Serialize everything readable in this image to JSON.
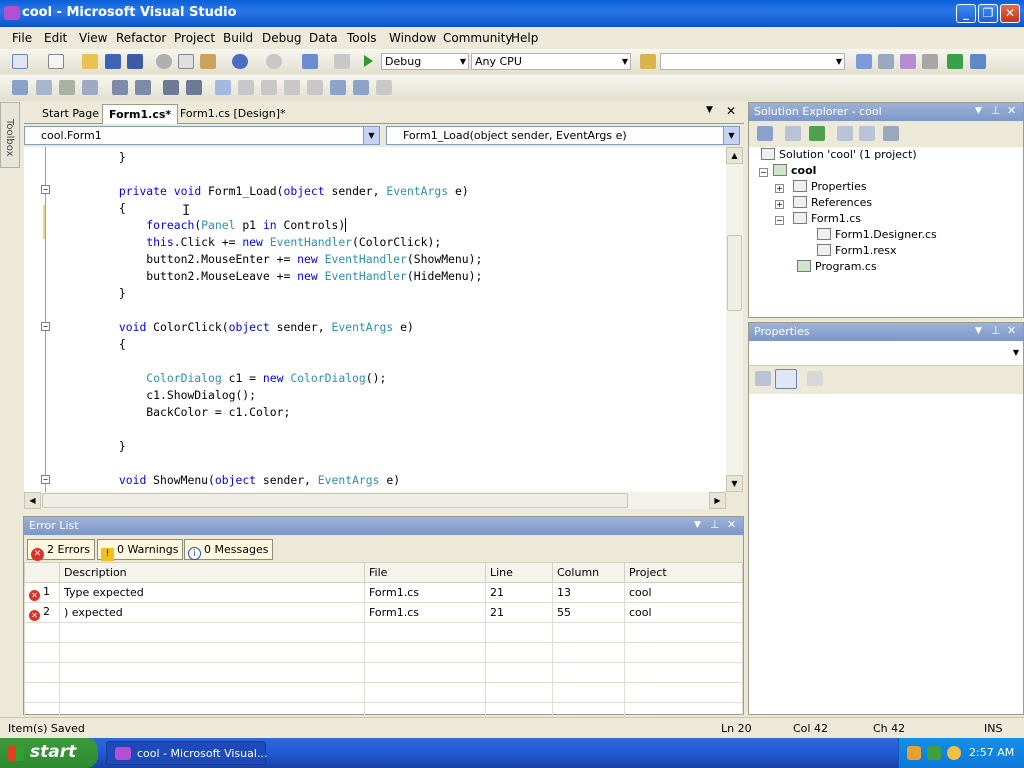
{
  "window": {
    "title": "cool - Microsoft Visual Studio"
  },
  "menu": [
    "File",
    "Edit",
    "View",
    "Refactor",
    "Project",
    "Build",
    "Debug",
    "Data",
    "Tools",
    "Window",
    "Community",
    "Help"
  ],
  "toolbar": {
    "config": "Debug",
    "platform": "Any CPU",
    "find": ""
  },
  "toolbox": {
    "label": "Toolbox"
  },
  "tabs": [
    "Start Page",
    "Form1.cs*",
    "Form1.cs [Design]*"
  ],
  "editor": {
    "class_combo": "cool.Form1",
    "member_combo": "Form1_Load(object sender, EventArgs e)",
    "lines": [
      "        }",
      "",
      "        private void Form1_Load(object sender, EventArgs e)",
      "        {",
      "            foreach(Panel p1 in Controls)",
      "            this.Click += new EventHandler(ColorClick);",
      "            button2.MouseEnter += new EventHandler(ShowMenu);",
      "            button2.MouseLeave += new EventHandler(HideMenu);",
      "        }",
      "",
      "        void ColorClick(object sender, EventArgs e)",
      "        {",
      "",
      "            ColorDialog c1 = new ColorDialog();",
      "            c1.ShowDialog();",
      "            BackColor = c1.Color;",
      "",
      "        }",
      "",
      "        void ShowMenu(object sender, EventArgs e)"
    ]
  },
  "solution_explorer": {
    "title": "Solution Explorer - cool",
    "items": [
      "Solution 'cool' (1 project)",
      "cool",
      "Properties",
      "References",
      "Form1.cs",
      "Form1.Designer.cs",
      "Form1.resx",
      "Program.cs"
    ]
  },
  "properties": {
    "title": "Properties"
  },
  "error_list": {
    "title": "Error List",
    "errors_btn": "2 Errors",
    "warnings_btn": "0 Warnings",
    "messages_btn": "0 Messages",
    "columns": [
      "Description",
      "File",
      "Line",
      "Column",
      "Project"
    ],
    "rows": [
      {
        "num": "1",
        "description": "Type expected",
        "file": "Form1.cs",
        "line": "21",
        "column": "13",
        "project": "cool"
      },
      {
        "num": "2",
        "description": ") expected",
        "file": "Form1.cs",
        "line": "21",
        "column": "55",
        "project": "cool"
      }
    ]
  },
  "status": {
    "message": "Item(s) Saved",
    "ln": "Ln 20",
    "col": "Col 42",
    "ch": "Ch 42",
    "mode": "INS"
  },
  "taskbar": {
    "start": "start",
    "task": "cool - Microsoft Visual...",
    "clock": "2:57 AM"
  },
  "colors": {
    "keyword": "#0000ff",
    "type": "#2b91af",
    "titlebar": "#0a5fd8",
    "panel_header": "#7d97c7"
  }
}
